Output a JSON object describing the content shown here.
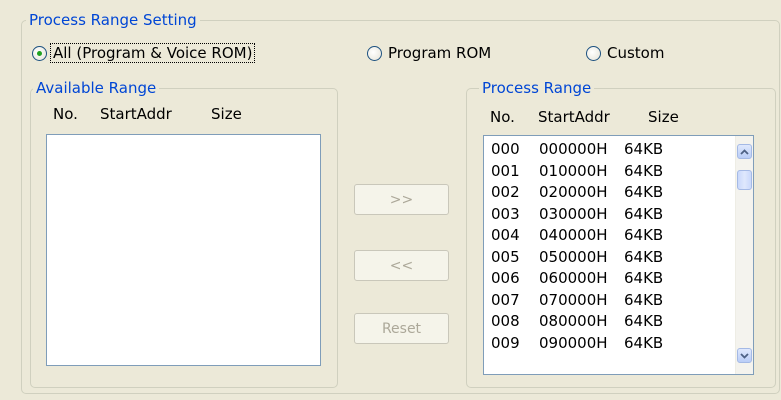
{
  "process_range_setting": {
    "title": "Process Range Setting",
    "options": [
      {
        "label": "All (Program & Voice ROM)",
        "selected": true
      },
      {
        "label": "Program ROM",
        "selected": false
      },
      {
        "label": "Custom",
        "selected": false
      }
    ]
  },
  "available_range": {
    "title": "Available Range",
    "columns": {
      "no": "No.",
      "start_addr": "StartAddr",
      "size": "Size"
    },
    "items": []
  },
  "process_range": {
    "title": "Process Range",
    "columns": {
      "no": "No.",
      "start_addr": "StartAddr",
      "size": "Size"
    },
    "items": [
      {
        "no": "000",
        "addr": "000000H",
        "size": "64KB"
      },
      {
        "no": "001",
        "addr": "010000H",
        "size": "64KB"
      },
      {
        "no": "002",
        "addr": "020000H",
        "size": "64KB"
      },
      {
        "no": "003",
        "addr": "030000H",
        "size": "64KB"
      },
      {
        "no": "004",
        "addr": "040000H",
        "size": "64KB"
      },
      {
        "no": "005",
        "addr": "050000H",
        "size": "64KB"
      },
      {
        "no": "006",
        "addr": "060000H",
        "size": "64KB"
      },
      {
        "no": "007",
        "addr": "070000H",
        "size": "64KB"
      },
      {
        "no": "008",
        "addr": "080000H",
        "size": "64KB"
      },
      {
        "no": "009",
        "addr": "090000H",
        "size": "64KB"
      }
    ]
  },
  "buttons": {
    "add": ">>",
    "remove": "<<",
    "reset": "Reset"
  },
  "colors": {
    "group_title": "#0046d5",
    "radio_selected": "#21a121",
    "disabled_text": "#aca899",
    "background": "#ece9d8"
  },
  "icons": {
    "scroll_up": "chevron-up-icon",
    "scroll_down": "chevron-down-icon"
  }
}
